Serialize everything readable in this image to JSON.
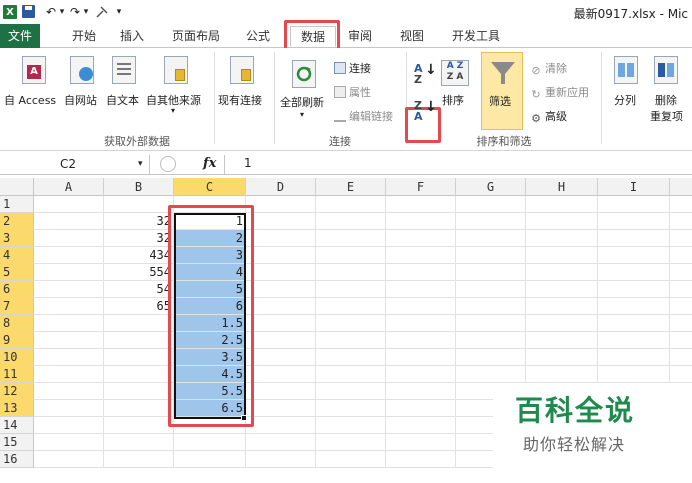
{
  "window": {
    "title": "最新0917.xlsx - Mic"
  },
  "quick_access": {
    "undo": "↶",
    "redo": "↷",
    "dropdown": "▾"
  },
  "tabs": [
    {
      "label": "文件"
    },
    {
      "label": "开始"
    },
    {
      "label": "插入"
    },
    {
      "label": "页面布局"
    },
    {
      "label": "公式"
    },
    {
      "label": "数据"
    },
    {
      "label": "审阅"
    },
    {
      "label": "视图"
    },
    {
      "label": "开发工具"
    }
  ],
  "ribbon": {
    "get_external": {
      "access": "自 Access",
      "web": "自网站",
      "text": "自文本",
      "other": "自其他来源",
      "existing": "现有连接",
      "label": "获取外部数据"
    },
    "connections": {
      "refresh_all": "全部刷新",
      "connections": "连接",
      "properties": "属性",
      "edit_links": "编辑链接",
      "label": "连接"
    },
    "sort_filter": {
      "sort": "排序",
      "filter": "筛选",
      "clear": "清除",
      "reapply": "重新应用",
      "advanced": "高级",
      "label": "排序和筛选"
    },
    "tools": {
      "split": "分列",
      "remove_dup_1": "删除",
      "remove_dup_2": "重复项"
    }
  },
  "formula_bar": {
    "name_box": "C2",
    "fx": "fx",
    "value": "1"
  },
  "columns": [
    "A",
    "B",
    "C",
    "D",
    "E",
    "F",
    "G",
    "H",
    "I"
  ],
  "rows": [
    "1",
    "2",
    "3",
    "4",
    "5",
    "6",
    "7",
    "8",
    "9",
    "10",
    "11",
    "12",
    "13",
    "14",
    "15",
    "16"
  ],
  "cells_b": [
    "",
    "32",
    "32",
    "434",
    "554",
    "54",
    "65",
    "",
    "",
    "",
    "",
    "",
    "",
    "",
    "",
    ""
  ],
  "cells_c": [
    "",
    "1",
    "2",
    "3",
    "4",
    "5",
    "6",
    "1.5",
    "2.5",
    "3.5",
    "4.5",
    "5.5",
    "6.5",
    "",
    "",
    ""
  ],
  "watermark": {
    "title": "百科全说",
    "subtitle": "助你轻松解决"
  },
  "colors": {
    "highlight": "#e5484d",
    "selection": "#9fc5ea",
    "file_tab": "#1e7145",
    "header_sel": "#fbd96a"
  }
}
